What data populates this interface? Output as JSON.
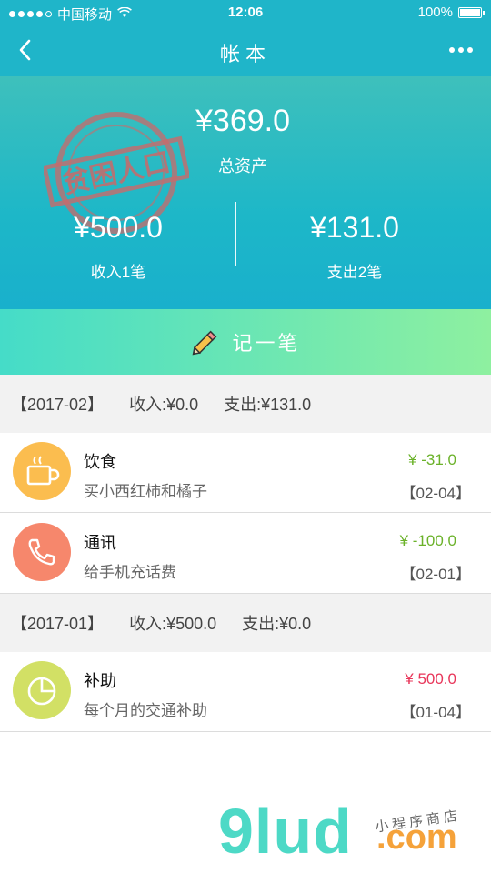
{
  "status_bar": {
    "carrier": "中国移动",
    "time": "12:06",
    "battery": "100%"
  },
  "nav": {
    "title": "帐本"
  },
  "summary": {
    "stamp_text": "贫困人口",
    "total_amount": "¥369.0",
    "total_label": "总资产",
    "income_amount": "¥500.0",
    "income_label": "收入1笔",
    "expense_amount": "¥131.0",
    "expense_label": "支出2笔"
  },
  "record_button": {
    "label": "记一笔"
  },
  "months": [
    {
      "period": "【2017-02】",
      "income": "收入:¥0.0",
      "expense": "支出:¥131.0",
      "entries": [
        {
          "category": "饮食",
          "note": "买小西红柿和橘子",
          "amount": "¥ -31.0",
          "date": "【02-04】",
          "icon": "coffee-cup-icon",
          "color": "#fbbd4f"
        },
        {
          "category": "通讯",
          "note": "给手机充话费",
          "amount": "¥ -100.0",
          "date": "【02-01】",
          "icon": "phone-icon",
          "color": "#f6876c"
        }
      ]
    },
    {
      "period": "【2017-01】",
      "income": "收入:¥500.0",
      "expense": "支出:¥0.0",
      "entries": [
        {
          "category": "补助",
          "note": "每个月的交通补助",
          "amount": "¥ 500.0",
          "date": "【01-04】",
          "icon": "pie-chart-icon",
          "color": "#d2e065"
        }
      ]
    }
  ],
  "colors": {
    "header": "#1fb5c9",
    "expense_green": "#6bb22a",
    "income_red": "#e8365a"
  },
  "watermark": {
    "brand": "9lud",
    "domain": ".com",
    "tagline": "小程序商店"
  }
}
